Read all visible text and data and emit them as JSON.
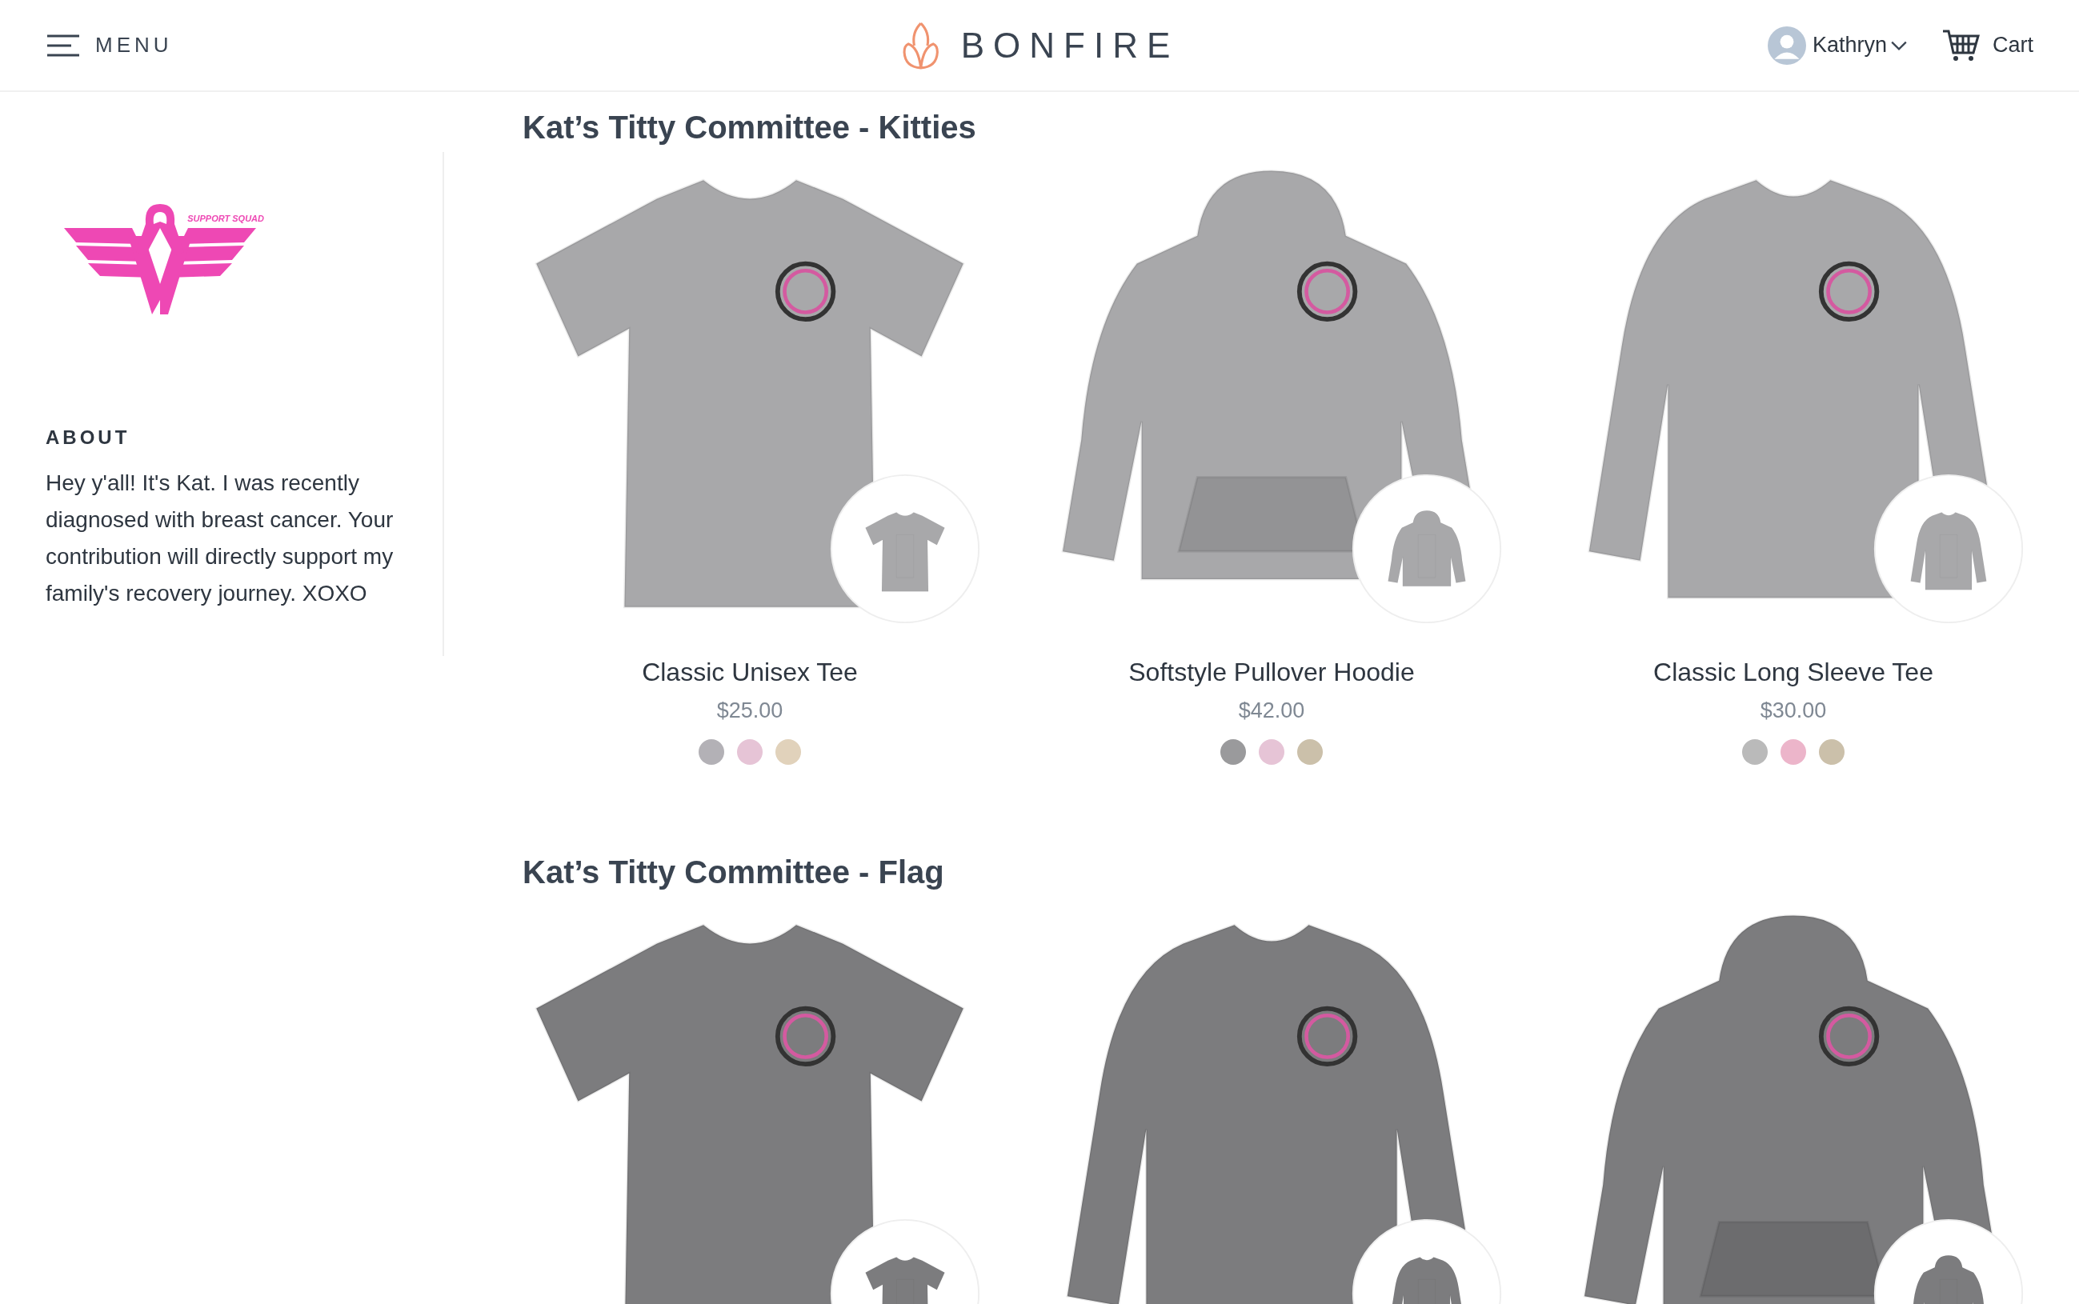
{
  "header": {
    "menu_label": "MENU",
    "brand": "BONFIRE",
    "user_name": "Kathryn",
    "cart_label": "Cart"
  },
  "sidebar": {
    "logo_tagline": "SUPPORT SQUAD",
    "about_heading": "ABOUT",
    "about_text": "Hey y'all! It's Kat. I was recently diagnosed with breast cancer. Your contribution will directly support my family's recovery journey. XOXO"
  },
  "sections": [
    {
      "title": "Kat’s Titty Committee - Kitties",
      "products": [
        {
          "kind": "tee",
          "name": "Classic Unisex Tee",
          "price": "$25.00",
          "colors": [
            {
              "color": "#b3b1b6"
            },
            {
              "color": "#e6c4d6"
            },
            {
              "color": "#e1d2bb"
            }
          ]
        },
        {
          "kind": "hoodie",
          "name": "Softstyle Pullover Hoodie",
          "price": "$42.00",
          "colors": [
            {
              "color": "#9a9a9c"
            },
            {
              "color": "#e6c4d6"
            },
            {
              "color": "#cbc0aa"
            }
          ]
        },
        {
          "kind": "longsleeve",
          "name": "Classic Long Sleeve Tee",
          "price": "$30.00",
          "colors": [
            {
              "color": "#bababa"
            },
            {
              "color": "#ecb5ca"
            },
            {
              "color": "#cbc0aa"
            }
          ]
        }
      ]
    },
    {
      "title": "Kat’s Titty Committee - Flag",
      "products": [
        {
          "kind": "tee"
        },
        {
          "kind": "longsleeve"
        },
        {
          "kind": "hoodie"
        }
      ]
    }
  ]
}
